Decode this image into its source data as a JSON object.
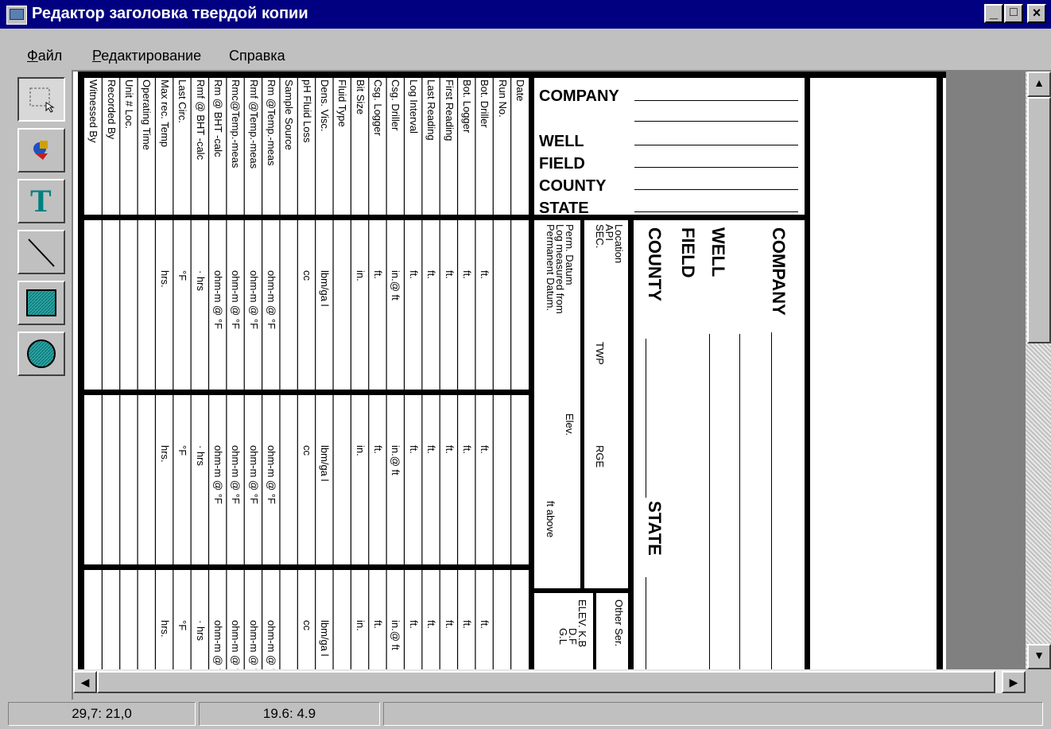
{
  "window": {
    "title": "Редактор заголовка твердой копии",
    "controls": {
      "minimize": "_",
      "maximize": "□",
      "close": "×"
    }
  },
  "menu": [
    {
      "label": "Файл",
      "accel": "Ф",
      "rest": "айл"
    },
    {
      "label": "Редактирование",
      "accel": "Р",
      "rest": "едактирование"
    },
    {
      "label": "Справка",
      "accel": "",
      "rest": "Справка"
    }
  ],
  "tools": [
    {
      "name": "select-tool",
      "icon": "selection-rect-icon",
      "pressed": true
    },
    {
      "name": "image-tool",
      "icon": "image-insert-icon"
    },
    {
      "name": "text-tool",
      "icon": "text-T-icon",
      "glyph": "T"
    },
    {
      "name": "line-tool",
      "icon": "line-icon"
    },
    {
      "name": "rectangle-tool",
      "icon": "rectangle-icon"
    },
    {
      "name": "ellipse-tool",
      "icon": "ellipse-icon"
    }
  ],
  "header": {
    "company_block": [
      "COMPANY",
      "WELL",
      "FIELD",
      "COUNTY",
      "STATE"
    ],
    "rotated_block": [
      "COMPANY",
      "WELL",
      "FIELD",
      "COUNTY"
    ],
    "state_rot": "STATE",
    "location": {
      "location": "Location",
      "api": "API",
      "sec": "SEC.",
      "twp": "TWP",
      "rge": "RGE"
    },
    "datum": {
      "perm": "Perm. Datum",
      "log_measured": "Log measured from",
      "permanent": "Permanent Datum.",
      "elev": "Elev.",
      "ft_above": "ft above"
    },
    "elev": {
      "elev_kb": "ELEV. K.B",
      "df": "D.F",
      "gl": "G.L",
      "other_services": "Other Ser."
    },
    "labels": [
      "Date",
      "Run No.",
      "Bot. Driller",
      "Bot. Logger",
      "First Reading",
      "Last Reading",
      "Log Interval",
      "Csg. Driller",
      "Csg. Logger",
      "Bit Size",
      "Fluid Type",
      "Dens. Visc.",
      "pH Fluid Loss",
      "Sample Source",
      "Rm @Temp.-meas",
      "Rmf @Temp.-meas",
      "Rmc@Temp.-meas",
      "Rm @ BHT -calc",
      "Rmf @ BHT -calc",
      "Last Circ.",
      "Max rec. Temp",
      "Operating Time",
      "Unit # Loc.",
      "Recorded By",
      "Witnessed By"
    ],
    "units": [
      "",
      "",
      "ft.",
      "ft.",
      "ft.",
      "ft.",
      "ft.",
      "in.@        ft",
      "ft.",
      "in.",
      "",
      "lbm/ga l",
      "cc",
      "",
      "ohm-m @      °F",
      "ohm-m @      °F",
      "ohm-m @      °F",
      "ohm-m @      °F",
      "·        hrs",
      "°F",
      "hrs.",
      "",
      "",
      "",
      ""
    ]
  },
  "status": {
    "coords": "29,7: 21,0",
    "value": "19.6: 4.9",
    "extra": ""
  }
}
